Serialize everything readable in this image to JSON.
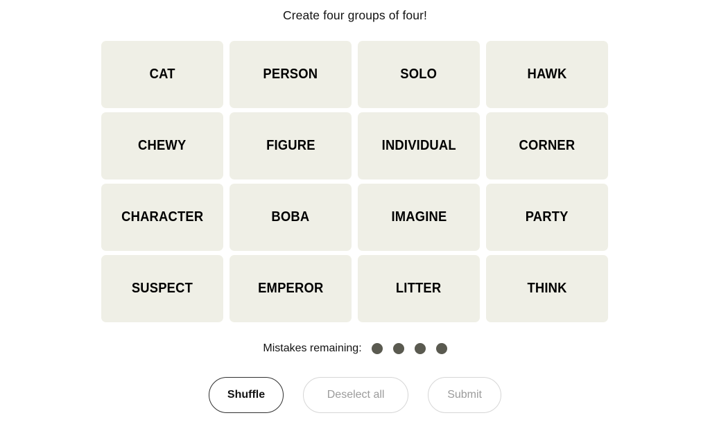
{
  "header": {
    "title": "Create four groups of four!"
  },
  "board": {
    "tiles": [
      {
        "label": "CAT"
      },
      {
        "label": "PERSON"
      },
      {
        "label": "SOLO"
      },
      {
        "label": "HAWK"
      },
      {
        "label": "CHEWY"
      },
      {
        "label": "FIGURE"
      },
      {
        "label": "INDIVIDUAL"
      },
      {
        "label": "CORNER"
      },
      {
        "label": "CHARACTER"
      },
      {
        "label": "BOBA"
      },
      {
        "label": "IMAGINE"
      },
      {
        "label": "PARTY"
      },
      {
        "label": "SUSPECT"
      },
      {
        "label": "EMPEROR"
      },
      {
        "label": "LITTER"
      },
      {
        "label": "THINK"
      }
    ]
  },
  "mistakes": {
    "label": "Mistakes remaining:",
    "remaining": 4,
    "dot_color": "#5a5a50"
  },
  "controls": {
    "shuffle_label": "Shuffle",
    "deselect_label": "Deselect all",
    "submit_label": "Submit"
  },
  "colors": {
    "page_background": "#ffffff",
    "tile_background": "#efefe6",
    "tile_text": "#000000",
    "title_text": "#121212",
    "enabled_border": "#2f2f2f",
    "disabled_border": "#d6d6d6",
    "disabled_text": "#9b9b9b"
  }
}
